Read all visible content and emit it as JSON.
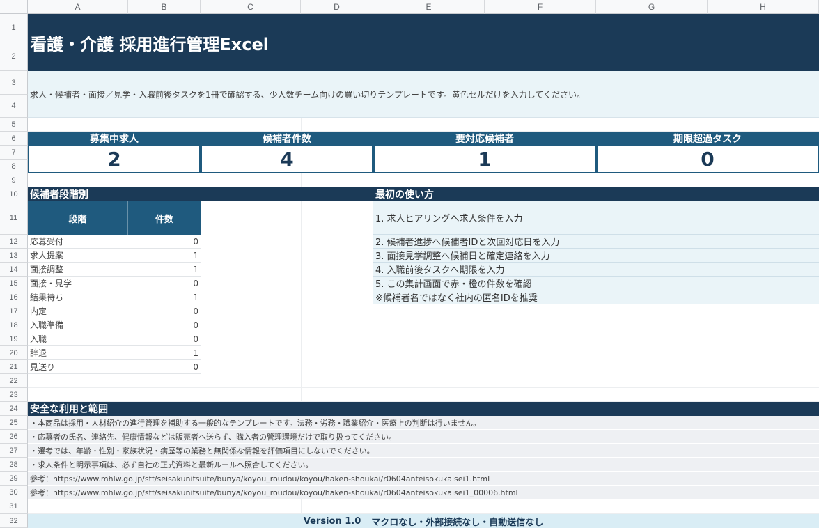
{
  "columns": [
    "A",
    "B",
    "C",
    "D",
    "E",
    "F",
    "G",
    "H"
  ],
  "rows": [
    "1",
    "2",
    "3",
    "4",
    "5",
    "6",
    "7",
    "8",
    "9",
    "10",
    "11",
    "12",
    "13",
    "14",
    "15",
    "16",
    "17",
    "18",
    "19",
    "20",
    "21",
    "22",
    "23",
    "24",
    "25",
    "26",
    "27",
    "28",
    "29",
    "30",
    "31",
    "32"
  ],
  "title": "看護・介護 採用進行管理Excel",
  "description": "求人・候補者・面接／見学・入職前後タスクを1冊で確認する、少人数チーム向けの買い切りテンプレートです。黄色セルだけを入力してください。",
  "kpis": [
    {
      "label": "募集中求人",
      "value": "2"
    },
    {
      "label": "候補者件数",
      "value": "4"
    },
    {
      "label": "要対応候補者",
      "value": "1"
    },
    {
      "label": "期限超過タスク",
      "value": "0"
    }
  ],
  "stages": {
    "title": "候補者段階別",
    "col_stage": "段階",
    "col_count": "件数",
    "items": [
      {
        "name": "応募受付",
        "count": "0"
      },
      {
        "name": "求人提案",
        "count": "1"
      },
      {
        "name": "面接調整",
        "count": "1"
      },
      {
        "name": "面接・見学",
        "count": "0"
      },
      {
        "name": "結果待ち",
        "count": "1"
      },
      {
        "name": "内定",
        "count": "0"
      },
      {
        "name": "入職準備",
        "count": "0"
      },
      {
        "name": "入職",
        "count": "0"
      },
      {
        "name": "辞退",
        "count": "1"
      },
      {
        "name": "見送り",
        "count": "0"
      }
    ]
  },
  "howto": {
    "title": "最初の使い方",
    "steps": [
      "1. 求人ヒアリングへ求人条件を入力",
      "2. 候補者進捗へ候補者IDと次回対応日を入力",
      "3. 面接見学調整へ候補日と確定連絡を入力",
      "4. 入職前後タスクへ期限を入力",
      "5. この集計画面で赤・橙の件数を確認",
      "※候補者名ではなく社内の匿名IDを推奨"
    ]
  },
  "safety": {
    "title": "安全な利用と範囲",
    "notes": [
      "・本商品は採用・人材紹介の進行管理を補助する一般的なテンプレートです。法務・労務・職業紹介・医療上の判断は行いません。",
      "・応募者の氏名、連絡先、健康情報などは販売者へ送らず、購入者の管理環境だけで取り扱ってください。",
      "・選考では、年齢・性別・家族状況・病歴等の業務と無関係な情報を評価項目にしないでください。",
      "・求人条件と明示事項は、必ず自社の正式資料と最新ルールへ照合してください。",
      "参考：https://www.mhlw.go.jp/stf/seisakunitsuite/bunya/koyou_roudou/koyou/haken-shoukai/r0604anteisokukaisei1.html",
      "参考：https://www.mhlw.go.jp/stf/seisakunitsuite/bunya/koyou_roudou/koyou/haken-shoukai/r0604anteisokukaisei1_00006.html"
    ]
  },
  "footer": {
    "version": "Version 1.0",
    "tagline": "マクロなし・外部接続なし・自動送信なし"
  },
  "colors": {
    "title_bg": "#1b3a57",
    "header_bg": "#1f5a7e",
    "light_bg": "#eaf4f8",
    "footer_bg": "#d9edf5"
  }
}
